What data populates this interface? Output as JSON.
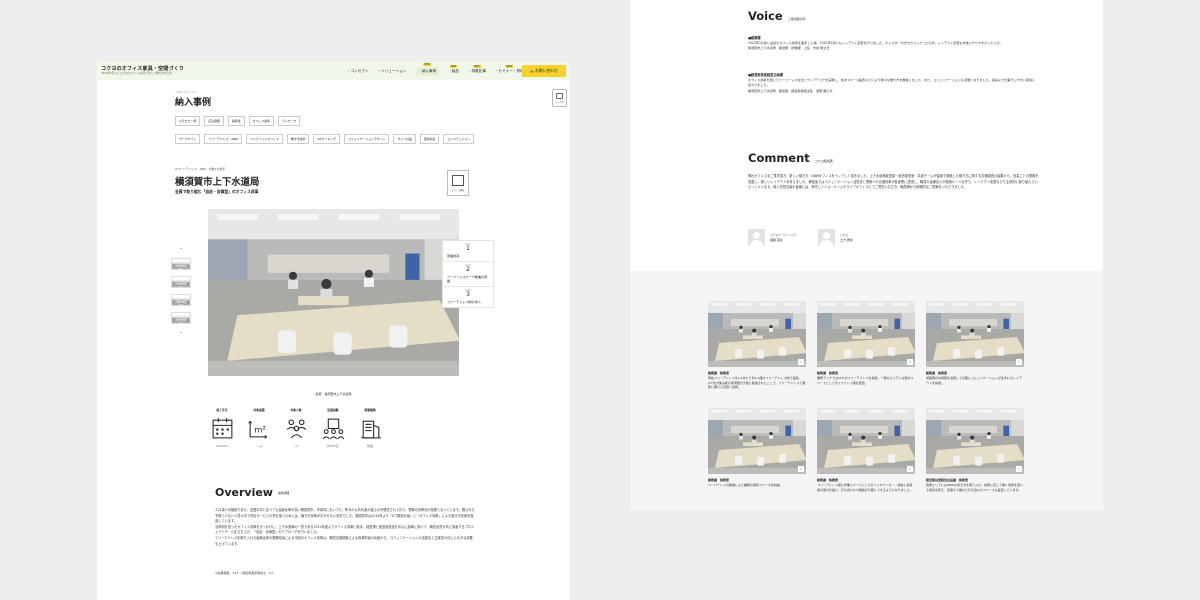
{
  "header": {
    "logo_main": "コクヨのオフィス家具・空間づくり",
    "logo_sub": "2022年3月からコクヨのオフィス家具で新しい働き方を実現",
    "nav": [
      {
        "label": "・コンセプト",
        "new": false,
        "active": false
      },
      {
        "label": "・ソリューション",
        "new": false,
        "active": false
      },
      {
        "label": "・納入事例",
        "new": true,
        "active": true
      },
      {
        "label": "・製品",
        "new": true,
        "active": false
      },
      {
        "label": "・特集記事",
        "new": true,
        "active": false
      },
      {
        "label": "・セミナー・資料",
        "new": true,
        "active": false
      }
    ],
    "new_tag": "NEW",
    "contact": "お問い合わせ"
  },
  "section": {
    "kana": "ノウニュウ ジレイ",
    "title": "納入事例",
    "filter_label": "フィルタ"
  },
  "tags_row1": [
    "ひそかさ一杯",
    "応込保留",
    "静音性",
    "オフィス改革",
    "テレワーク"
  ],
  "tags_row2": [
    "ワークサイト",
    "フリーアドレス・ABW",
    "ハイブリッドオフィス",
    "働き方改革",
    "DXワーキング",
    "コミュニケーションデザイン",
    "サイン計画",
    "環境共生",
    "コンペティション"
  ],
  "case": {
    "crumb": "#フリーアドレス・ABW　#働き方改革",
    "title": "横須賀市上下水道局",
    "subtitle": "全員で取り組む「自走・自律型」のオフィス改革",
    "icon_label": "オフィス移転",
    "caption": "名称　横須賀市上下水道局",
    "points_label": "Point",
    "points": [
      {
        "num": "1",
        "text": "意識改革"
      },
      {
        "num": "2",
        "text": "ペーパーレスワーク推進の意識"
      },
      {
        "num": "3",
        "text": "フリーアドレス制の導入"
      }
    ]
  },
  "stats": [
    {
      "label": "竣工年月",
      "value": "2022/03",
      "icon": "calendar-icon"
    },
    {
      "label": "対象面積",
      "value": "—㎡",
      "icon": "area-icon"
    },
    {
      "label": "対象人数",
      "value": "—人",
      "icon": "people-icon"
    },
    {
      "label": "従業員数",
      "value": "約387名"
    },
    {
      "label": "建築種類",
      "value": "既築",
      "icon": "building-icon"
    }
  ],
  "overview": {
    "title": "Overview",
    "sub": "事例詳細",
    "body": "人口減少が継続であり、全国平均と比べても高齢化率が高い横須賀市。市域内においても、昨今の公共料金の値上げが懸念されており、業務の効率化が急務となっています。限られた予算と少ない人員の中で市民サービスの質を保つためには、働き方改革が欠かせない状況でした。横須賀市は2019年より「ICT推進計画」と「オフィス改革」による働き方改革を推進しています。\n当事例を担ったオフィス改革をきっかけに、上下水道局の一員である2022年度よりオフィス改革に着手、経営課と経営部長室を中心に部局に向けて、職員全員が共に参画するプロジェクトチームを立ち上げ、「自走・自律型」のアプローチを行いました。\nフリーアドレスを取り入れた組織全体の業務改善による今回のオフィス改革は、職員意識調査による改革前後の比較から、コミュニケーションの活性化と生産性の向上に大きな成果を上げています。",
    "note": "※従業員数：19人 / 経営部長室等含む：6人"
  },
  "voice": {
    "title": "Voice",
    "sub": "ご担当者の声",
    "blocks": [
      {
        "head": "■総務課",
        "text": "2022年1月末に最初のオフィス改革を着手した後、2022年5月にもレイアウト変更を行いました。キャスター付きのワゴンだったため、レイアウト変更も非常にやりやすかったです。\n横須賀市上下水道局　経営部　総務課　上任　竹崎 隆之氏"
      },
      {
        "head": "■経営部長室経営企画課",
        "text": "オフィス改革を通じてペーパーレス文化とクリアデスクを実現し、集中スペース設置などにより様々な働き方を推進しました。また、コミュニケーションも活発になりました。従来より仕事がしやすい環境に変わりました。\n横須賀市上下水道局　経営部　経営部長室主任　波野 勝子氏"
      }
    ]
  },
  "comment": {
    "title": "Comment",
    "sub": "コクヨ担当者",
    "body": "弊社オフィスをご見学頂き、新しい働き方・ABWオフィスをインプット頂きました。上下水道局経営部・経営部長室・共創チームが協働で実施した働き方に関する意識調査の結果から、改善ごとの業務を見直し、新しいレイアウトを考えました。移転後ではコミュニケーション活性化と業務への意識改革が各部署に浸透し、職員の皆様自らが運用ルールを作り、レイアウト変更なども主体的に取り組んでいらっしゃいます。納入先担当者の皆様には、率先してショールームやライブオフィスにてご見学いただき、職員様から積極的なご提案をいただきました。",
    "persons": [
      {
        "role": "コクヨマーケティング",
        "name": "堀越 英生"
      },
      {
        "role": "コクヨ",
        "name": "土方 勇信"
      }
    ]
  },
  "gallery": [
    {
      "cat": "総務課　執務室",
      "text": "現在フリーアドレスを1人あたり約1.4席のフリーアドレス制で運用。ICT化が進み紙の使用量が大幅に削減されたことで、フリーアドレスで柔軟に働ける空間へ改修。"
    },
    {
      "cat": "総務課　執務室",
      "text": "業務デスクでは50%のフリーアドレスを採用。一部のエリアには集中スペースとしてのファミレス席を配置。"
    },
    {
      "cat": "総務課　執務室",
      "text": "通路側の共用部を活用して気軽にコミュニケーションが生まれるレイアウトを採用。"
    },
    {
      "cat": "総務課　執務室",
      "text": "ペーパーレスの推進により書類の保管スペースを削減。"
    },
    {
      "cat": "総務課　執務室",
      "text": "フリーアドレス席に作業スペースとしてのハイカウンター、収納と来客用の受付を設け、打ち合わせや相談が気軽にできるようになりました。"
    },
    {
      "cat": "経営部長室経営企画課　執務室",
      "text": "執務エリアにはABWの考え方を取り入れ、執務に応じて働く場所を選べる環境を整え、自席から離れた打ち合わせスペースも設置しています。"
    }
  ]
}
